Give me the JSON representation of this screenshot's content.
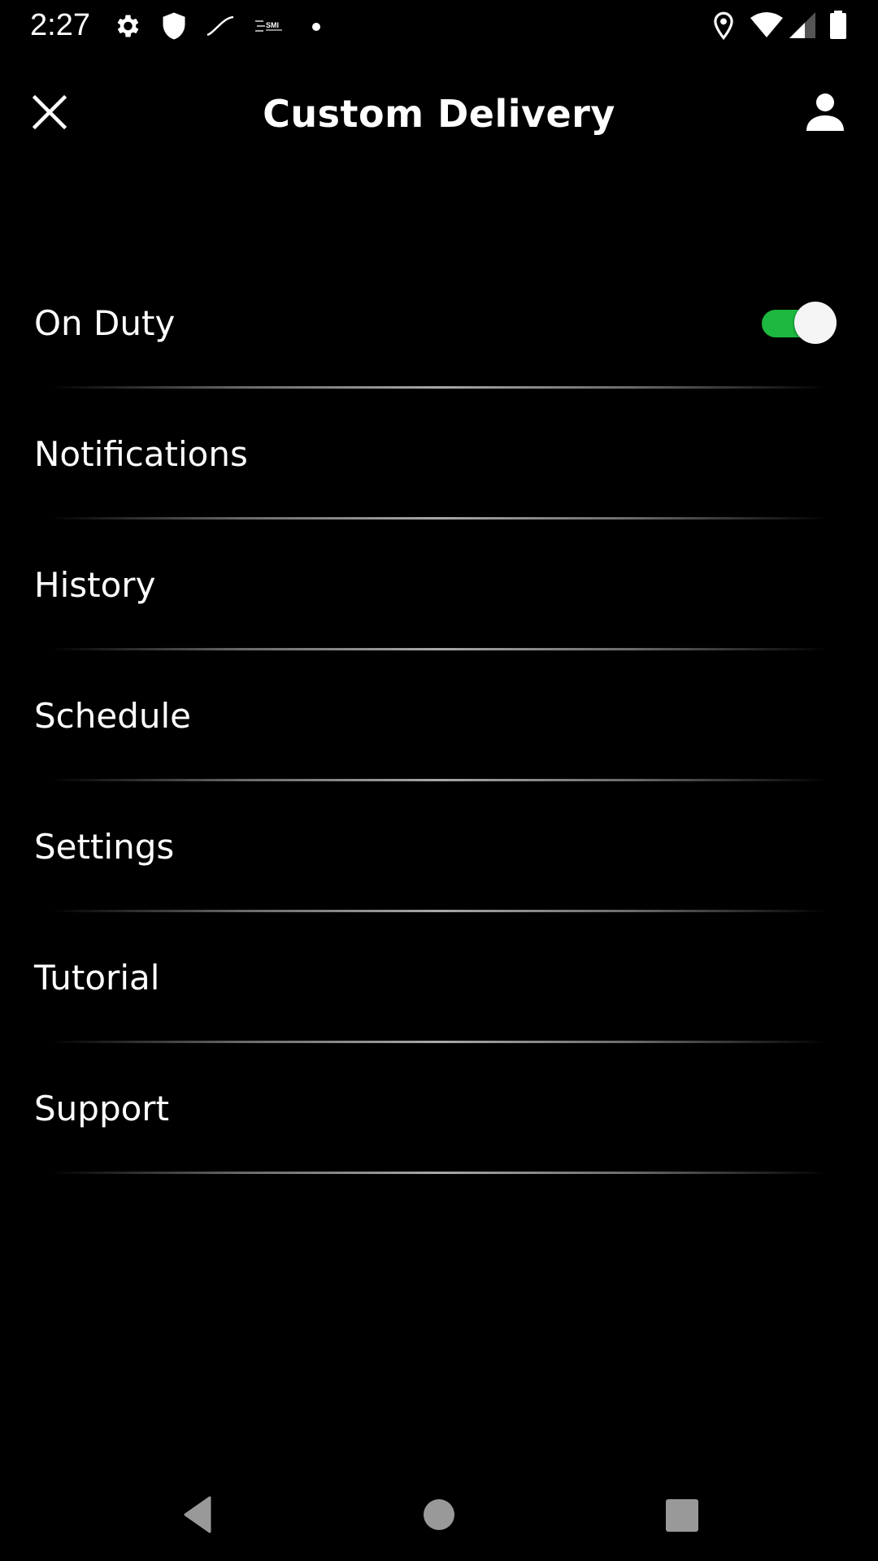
{
  "status_bar": {
    "time": "2:27",
    "left_icons": [
      "settings-icon",
      "shield-icon",
      "stylus-icon",
      "smi-icon",
      "notification-dot-icon"
    ],
    "right_icons": [
      "location-icon",
      "wifi-icon",
      "cell-signal-icon",
      "battery-icon"
    ]
  },
  "header": {
    "title": "Custom Delivery",
    "left_icon": "close-icon",
    "right_icon": "account-icon"
  },
  "menu": {
    "items": [
      {
        "label": "On Duty",
        "has_toggle": true,
        "toggle_on": true
      },
      {
        "label": "Notifications"
      },
      {
        "label": "History"
      },
      {
        "label": "Schedule"
      },
      {
        "label": "Settings"
      },
      {
        "label": "Tutorial"
      },
      {
        "label": "Support"
      }
    ]
  },
  "colors": {
    "background": "#000000",
    "toggle_on": "#1db83f",
    "nav_icons": "#999999"
  },
  "nav_bar": {
    "buttons": [
      "back",
      "home",
      "recents"
    ]
  }
}
